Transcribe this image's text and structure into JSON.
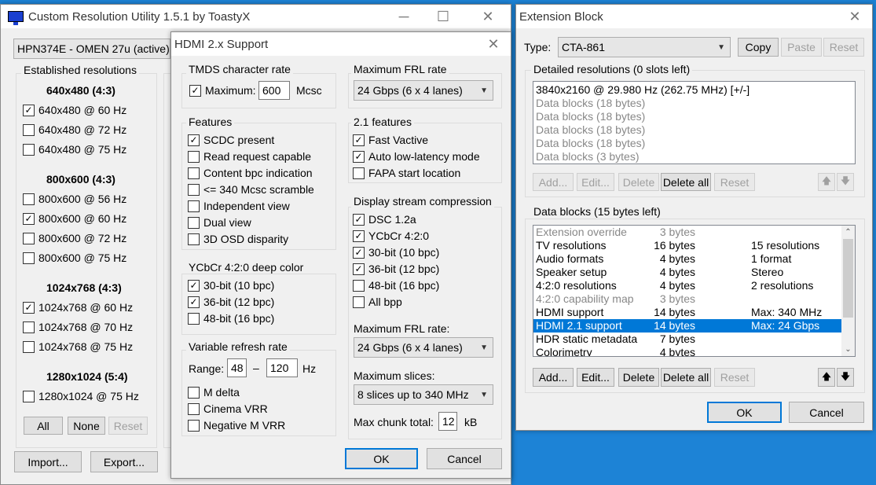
{
  "main": {
    "title": "Custom Resolution Utility 1.5.1 by ToastyX",
    "monitor": "HPN374E - OMEN 27u (active)",
    "established_label": "Established resolutions",
    "groups": [
      {
        "header": "640x480 (4:3)",
        "items": [
          {
            "label": "640x480 @ 60 Hz",
            "checked": true
          },
          {
            "label": "640x480 @ 72 Hz",
            "checked": false
          },
          {
            "label": "640x480 @ 75 Hz",
            "checked": false
          }
        ]
      },
      {
        "header": "800x600 (4:3)",
        "items": [
          {
            "label": "800x600 @ 56 Hz",
            "checked": false
          },
          {
            "label": "800x600 @ 60 Hz",
            "checked": true
          },
          {
            "label": "800x600 @ 72 Hz",
            "checked": false
          },
          {
            "label": "800x600 @ 75 Hz",
            "checked": false
          }
        ]
      },
      {
        "header": "1024x768 (4:3)",
        "items": [
          {
            "label": "1024x768 @ 60 Hz",
            "checked": true
          },
          {
            "label": "1024x768 @ 70 Hz",
            "checked": false
          },
          {
            "label": "1024x768 @ 75 Hz",
            "checked": false
          }
        ]
      },
      {
        "header": "1280x1024 (5:4)",
        "items": [
          {
            "label": "1280x1024 @ 75 Hz",
            "checked": false
          }
        ]
      }
    ],
    "btn_all": "All",
    "btn_none": "None",
    "btn_reset": "Reset",
    "btn_import": "Import...",
    "btn_export": "Export..."
  },
  "hdmi": {
    "title": "HDMI 2.x Support",
    "tmds_label": "TMDS character rate",
    "maximum_label": "Maximum:",
    "maximum_value": "600",
    "mcsc": "Mcsc",
    "features_label": "Features",
    "features": [
      {
        "label": "SCDC present",
        "checked": true
      },
      {
        "label": "Read request capable",
        "checked": false
      },
      {
        "label": "Content bpc indication",
        "checked": false
      },
      {
        "label": "<= 340 Mcsc scramble",
        "checked": false
      },
      {
        "label": "Independent view",
        "checked": false
      },
      {
        "label": "Dual view",
        "checked": false
      },
      {
        "label": "3D OSD disparity",
        "checked": false
      }
    ],
    "ycbcr_label": "YCbCr 4:2:0 deep color",
    "ycbcr": [
      {
        "label": "30-bit (10 bpc)",
        "checked": true
      },
      {
        "label": "36-bit (12 bpc)",
        "checked": true
      },
      {
        "label": "48-bit (16 bpc)",
        "checked": false
      }
    ],
    "vrr_label": "Variable refresh rate",
    "range_label": "Range:",
    "range_min": "48",
    "range_dash": "–",
    "range_max": "120",
    "hz": "Hz",
    "vrr": [
      {
        "label": "M delta",
        "checked": false
      },
      {
        "label": "Cinema VRR",
        "checked": false
      },
      {
        "label": "Negative M VRR",
        "checked": false
      }
    ],
    "frl_label": "Maximum FRL rate",
    "frl_value": "24 Gbps (6 x 4 lanes)",
    "f21_label": "2.1 features",
    "f21": [
      {
        "label": "Fast Vactive",
        "checked": true
      },
      {
        "label": "Auto low-latency mode",
        "checked": true
      },
      {
        "label": "FAPA start location",
        "checked": false
      }
    ],
    "dsc_label": "Display stream compression",
    "dsc": [
      {
        "label": "DSC 1.2a",
        "checked": true
      },
      {
        "label": "YCbCr 4:2:0",
        "checked": true
      },
      {
        "label": "30-bit (10 bpc)",
        "checked": true
      },
      {
        "label": "36-bit (12 bpc)",
        "checked": true
      },
      {
        "label": "48-bit (16 bpc)",
        "checked": false
      },
      {
        "label": "All bpp",
        "checked": false
      }
    ],
    "frl2_label": "Maximum FRL rate:",
    "frl2_value": "24 Gbps (6 x 4 lanes)",
    "slices_label": "Maximum slices:",
    "slices_value": "8 slices up to 340 MHz",
    "chunk_label": "Max chunk total:",
    "chunk_value": "12",
    "kb": "kB",
    "ok": "OK",
    "cancel": "Cancel"
  },
  "ext": {
    "title": "Extension Block",
    "type_label": "Type:",
    "type_value": "CTA-861",
    "copy": "Copy",
    "paste": "Paste",
    "reset": "Reset",
    "detailed_label": "Detailed resolutions (0 slots left)",
    "detailed": [
      {
        "text": "3840x2160 @ 29.980 Hz (262.75 MHz) [+/-]",
        "gray": false
      },
      {
        "text": "Data blocks (18 bytes)",
        "gray": true
      },
      {
        "text": "Data blocks (18 bytes)",
        "gray": true
      },
      {
        "text": "Data blocks (18 bytes)",
        "gray": true
      },
      {
        "text": "Data blocks (18 bytes)",
        "gray": true
      },
      {
        "text": "Data blocks (3 bytes)",
        "gray": true
      }
    ],
    "btn_add": "Add...",
    "btn_edit": "Edit...",
    "btn_delete": "Delete",
    "btn_delete_all": "Delete all",
    "btn_reset": "Reset",
    "up": "🡅",
    "down": "🡇",
    "datablocks_label": "Data blocks (15 bytes left)",
    "datablocks": [
      {
        "name": "Extension override",
        "bytes": "3 bytes",
        "info": "",
        "gray": true,
        "sel": false
      },
      {
        "name": "TV resolutions",
        "bytes": "16 bytes",
        "info": "15 resolutions",
        "gray": false,
        "sel": false
      },
      {
        "name": "Audio formats",
        "bytes": "4 bytes",
        "info": "1 format",
        "gray": false,
        "sel": false
      },
      {
        "name": "Speaker setup",
        "bytes": "4 bytes",
        "info": "Stereo",
        "gray": false,
        "sel": false
      },
      {
        "name": "4:2:0 resolutions",
        "bytes": "4 bytes",
        "info": "2 resolutions",
        "gray": false,
        "sel": false
      },
      {
        "name": "4:2:0 capability map",
        "bytes": "3 bytes",
        "info": "",
        "gray": true,
        "sel": false
      },
      {
        "name": "HDMI support",
        "bytes": "14 bytes",
        "info": "Max: 340 MHz",
        "gray": false,
        "sel": false
      },
      {
        "name": "HDMI 2.1 support",
        "bytes": "14 bytes",
        "info": "Max: 24 Gbps",
        "gray": false,
        "sel": true
      },
      {
        "name": "HDR static metadata",
        "bytes": "7 bytes",
        "info": "",
        "gray": false,
        "sel": false
      },
      {
        "name": "Colorimetry",
        "bytes": "4 bytes",
        "info": "",
        "gray": false,
        "sel": false
      }
    ],
    "ok": "OK",
    "cancel": "Cancel"
  }
}
